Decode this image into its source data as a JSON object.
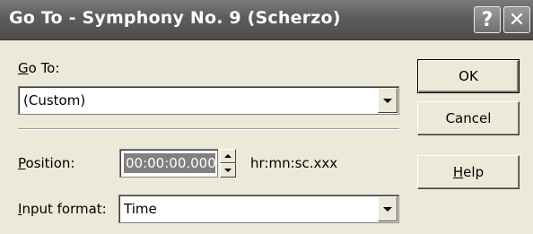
{
  "window": {
    "title": "Go To - Symphony No. 9 (Scherzo)",
    "help_glyph": "?",
    "close_glyph": "✕"
  },
  "goto": {
    "label_mnemonic": "G",
    "label_rest": "o To:",
    "selected": "(Custom)"
  },
  "position": {
    "label_mnemonic": "P",
    "label_rest": "osition:",
    "value": "00:00:00.000",
    "format_hint": "hr:mn:sc.xxx"
  },
  "input_format": {
    "label_mnemonic": "I",
    "label_rest": "nput format:",
    "selected": "Time"
  },
  "buttons": {
    "ok": "OK",
    "cancel": "Cancel",
    "help_mnemonic": "H",
    "help_rest": "elp"
  },
  "icons": {
    "help": "help-question-icon",
    "close": "close-x-icon",
    "dropdown": "chevron-down-icon",
    "spin_up": "spin-up-arrow-icon",
    "spin_down": "spin-down-arrow-icon"
  }
}
